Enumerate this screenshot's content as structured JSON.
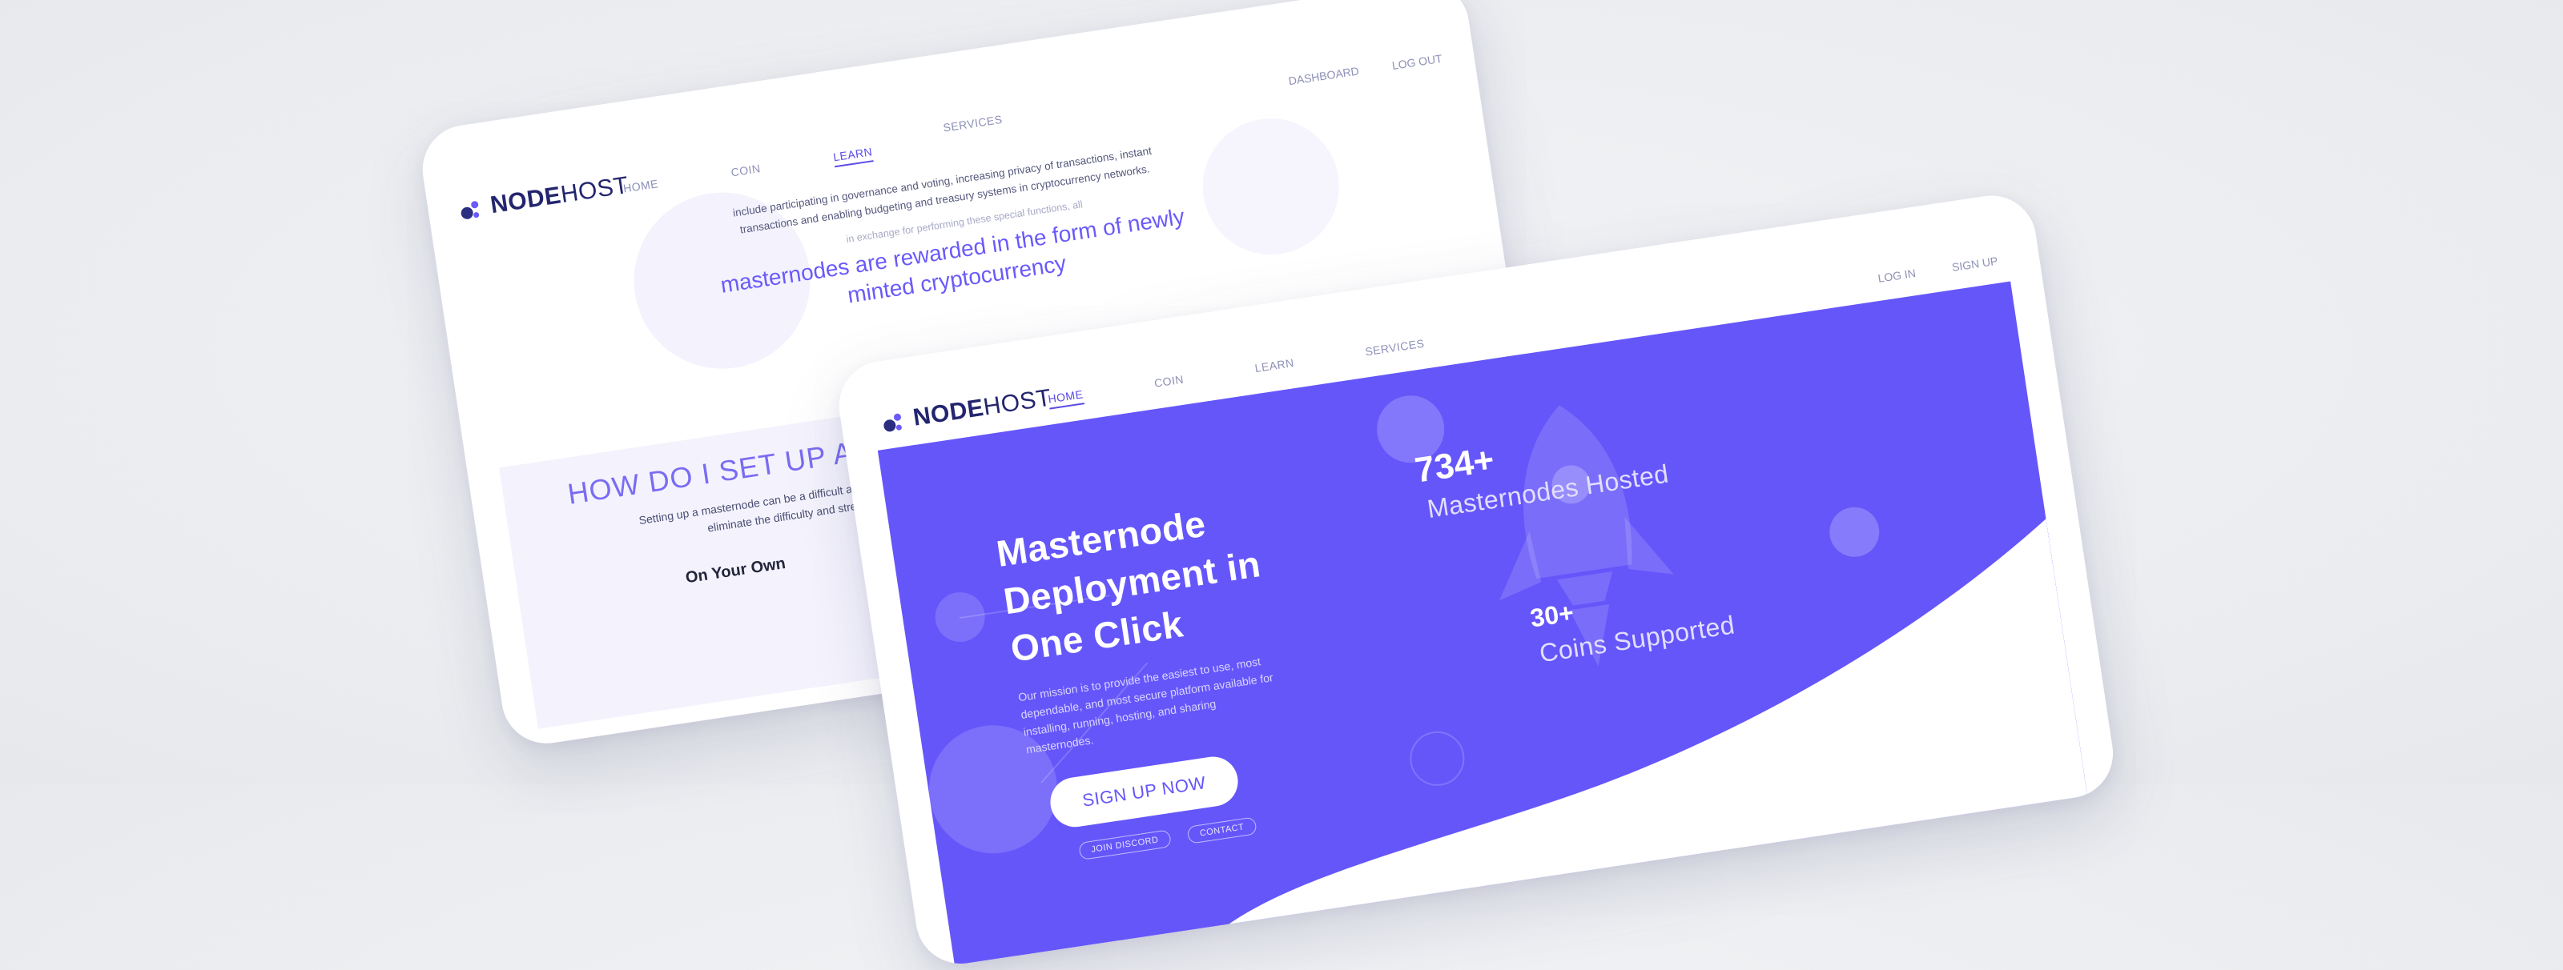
{
  "back_screen": {
    "logo": {
      "bold": "NODE",
      "light": "HOST"
    },
    "nav": [
      "HOME",
      "COIN",
      "LEARN",
      "SERVICES"
    ],
    "active_nav": "LEARN",
    "account": [
      "DASHBOARD",
      "LOG OUT"
    ],
    "copy": "include participating in governance and voting, increasing privacy of transactions, instant transactions and enabling budgeting and treasury systems in cryptocurrency networks.",
    "note": "in exchange for performing these special functions, all",
    "headline": "masternodes are rewarded in the form of newly minted cryptocurrency",
    "section_title": "HOW DO I SET UP A N",
    "section_text": "Setting up a masternode can be a difficult and t NodeHost to eliminate the difficulty and stream",
    "section_sub": "On Your Own"
  },
  "front_screen": {
    "logo": {
      "bold": "NODE",
      "light": "HOST"
    },
    "nav": [
      "HOME",
      "COIN",
      "LEARN",
      "SERVICES"
    ],
    "active_nav": "HOME",
    "account": [
      "LOG IN",
      "SIGN UP"
    ],
    "hero": {
      "title": "Masternode Deployment in One Click",
      "mission": "Our mission is to provide the easiest to use, most dependable, and most secure platform available for installing, running, hosting, and sharing masternodes.",
      "cta": "SIGN UP NOW",
      "secondary": [
        "JOIN DISCORD",
        "CONTACT"
      ]
    },
    "stats": [
      {
        "value": "734+",
        "label": "Masternodes Hosted"
      },
      {
        "value": "30+",
        "label": "Coins Supported"
      }
    ],
    "icons": [
      "rocket-icon"
    ]
  },
  "colors": {
    "brand_purple": "#6556fa",
    "logo_navy": "#23256e",
    "nav_gray": "#8d90b6",
    "page_bg": "#eceef1"
  }
}
